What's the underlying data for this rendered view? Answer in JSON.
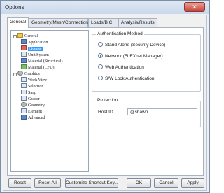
{
  "window": {
    "title": "Options",
    "close_glyph": "✕"
  },
  "tabs": [
    {
      "label": "General",
      "active": true
    },
    {
      "label": "Geometry/Mesh/Connections",
      "active": false
    },
    {
      "label": "Loads/B.C.",
      "active": false
    },
    {
      "label": "Analysis/Results",
      "active": false
    }
  ],
  "tree": {
    "general": "General",
    "application": "Application",
    "license": "License",
    "unit_system": "Unit System",
    "material_structural": "Material (Structural)",
    "material_cfd": "Material (CFD)",
    "graphics": "Graphics",
    "work_view": "Work View",
    "selection": "Selection",
    "snap": "Snap",
    "grader": "Grader",
    "geometry": "Geometry",
    "element": "Element",
    "advanced": "Advanced"
  },
  "auth": {
    "title": "Authentication Method",
    "options": [
      {
        "label": "Stand Alone (Security Device)",
        "checked": false
      },
      {
        "label": "Network (FLEXnet Manager)",
        "checked": true
      },
      {
        "label": "Web Authentication",
        "checked": false
      },
      {
        "label": "S/W Lock Authentication",
        "checked": false
      }
    ]
  },
  "protection": {
    "title": "Protection",
    "host_id_label": "Host ID",
    "host_id_value": "@shawn"
  },
  "buttons": {
    "reset": "Reset",
    "reset_all": "Reset All",
    "customize": "Customize Shortcut Key...",
    "ok": "OK",
    "cancel": "Cancel",
    "apply": "Apply"
  }
}
